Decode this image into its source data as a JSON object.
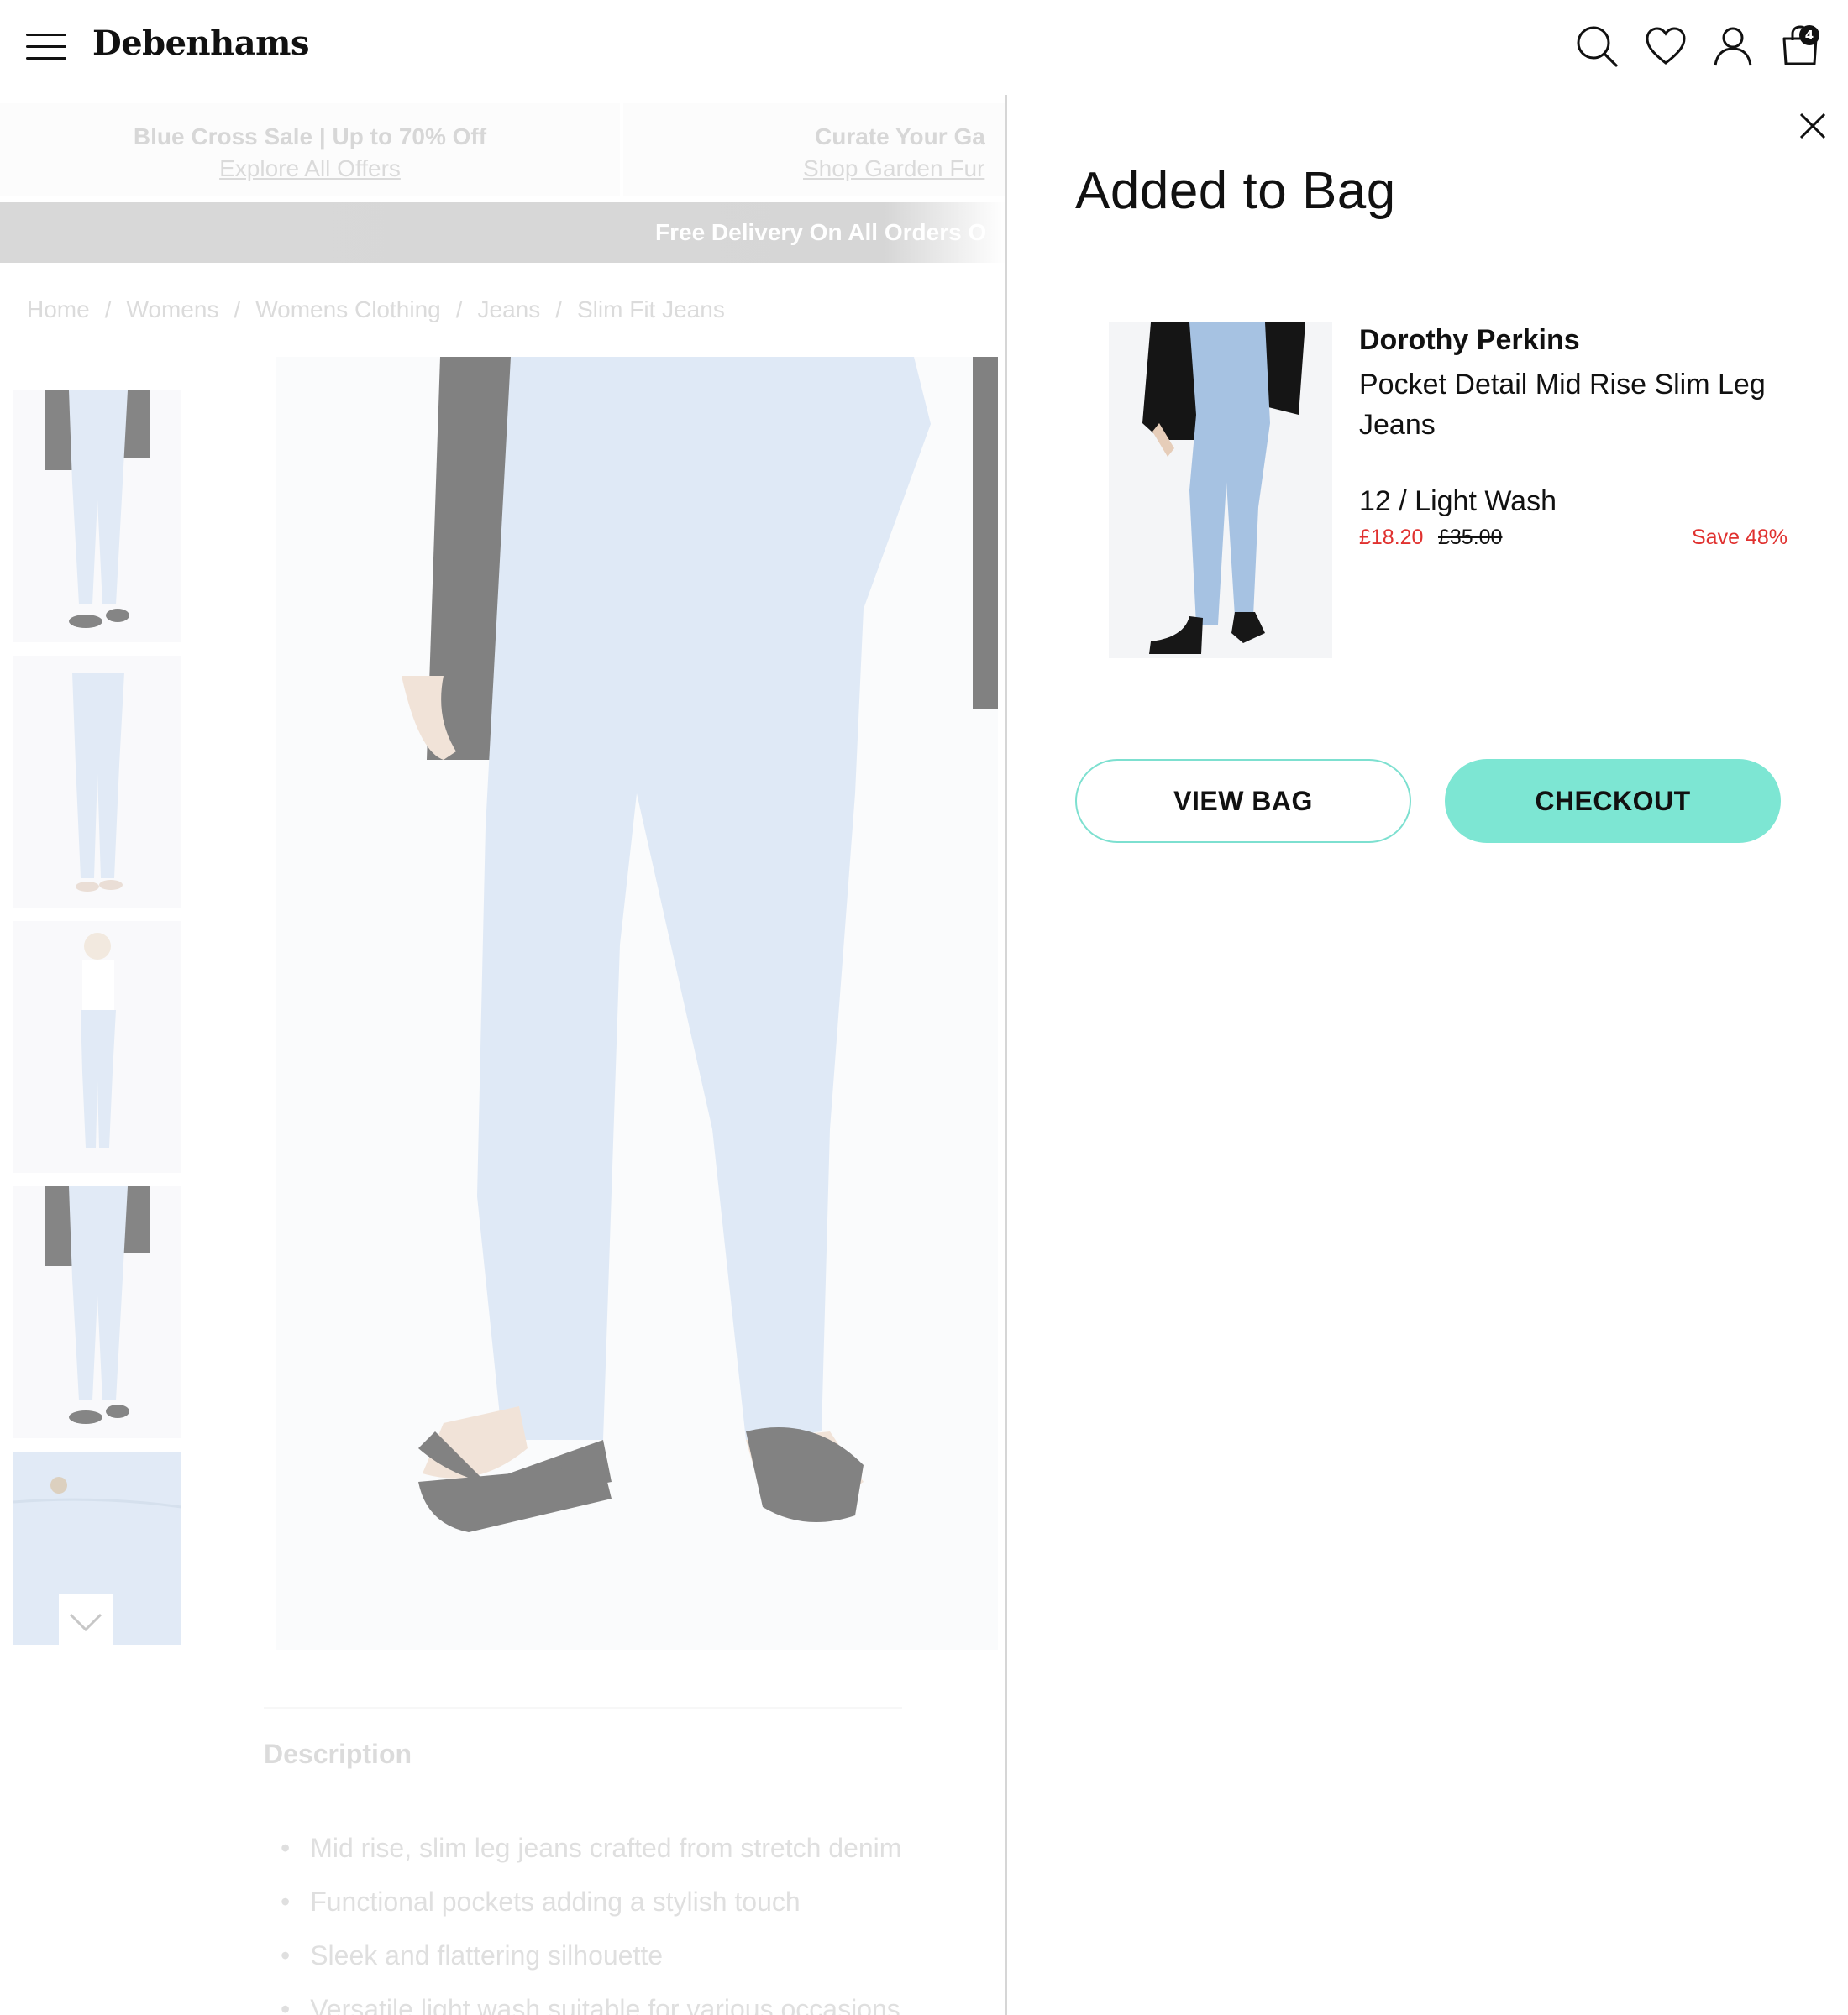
{
  "header": {
    "logo": "Debenhams",
    "icons": [
      "menu-icon",
      "search-icon",
      "heart-icon",
      "account-icon",
      "bag-icon"
    ],
    "bag_count": "4"
  },
  "promos": [
    {
      "title": "Blue Cross Sale | Up to 70% Off",
      "link": "Explore All Offers"
    },
    {
      "title": "Curate Your Ga",
      "link": "Shop Garden Fur"
    }
  ],
  "delivery_banner": "Free Delivery On All Orders O",
  "breadcrumb": [
    "Home",
    "Womens",
    "Womens Clothing",
    "Jeans",
    "Slim Fit Jeans"
  ],
  "description": {
    "title": "Description",
    "bullets": [
      "Mid rise, slim leg jeans crafted from stretch denim",
      "Functional pockets adding a stylish touch",
      "Sleek and flattering silhouette",
      "Versatile light wash suitable for various occasions"
    ]
  },
  "drawer": {
    "title": "Added to Bag",
    "item": {
      "brand": "Dorothy Perkins",
      "name": "Pocket Detail Mid Rise Slim Leg Jeans",
      "variant": "12 / Light Wash",
      "price": "£18.20",
      "was_price": "£35.00",
      "save": "Save 48%"
    },
    "view_bag_label": "VIEW BAG",
    "checkout_label": "CHECKOUT"
  },
  "colors": {
    "accent": "#7de6d3",
    "sale_red": "#e0312f",
    "denim": "#c5d8ee",
    "jacket": "#111111"
  }
}
